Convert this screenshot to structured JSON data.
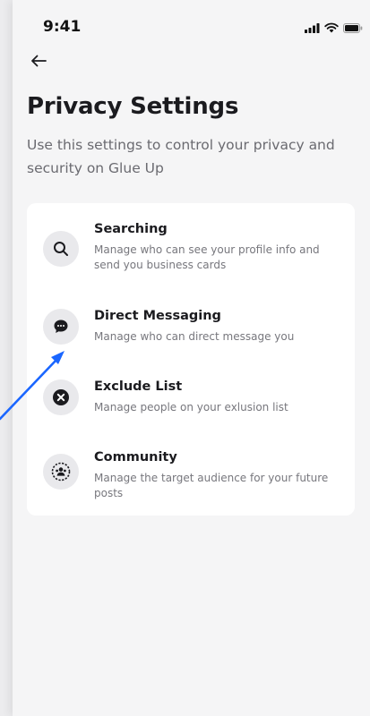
{
  "status_bar": {
    "time": "9:41"
  },
  "header": {
    "back_icon": "arrow-left-icon"
  },
  "page": {
    "title": "Privacy Settings",
    "subtitle": "Use this settings to control your privacy and security on Glue Up"
  },
  "settings": [
    {
      "icon": "search-icon",
      "title": "Searching",
      "description": "Manage who can see your profile info and send you business cards"
    },
    {
      "icon": "chat-bubble-icon",
      "title": "Direct Messaging",
      "description": "Manage who can direct message you"
    },
    {
      "icon": "close-circle-icon",
      "title": "Exclude List",
      "description": "Manage people on your exlusion list"
    },
    {
      "icon": "community-icon",
      "title": "Community",
      "description": "Manage the target audience for your future posts"
    }
  ],
  "colors": {
    "annotation_arrow": "#1a66ff",
    "background": "#f5f5f6",
    "card": "#ffffff"
  }
}
